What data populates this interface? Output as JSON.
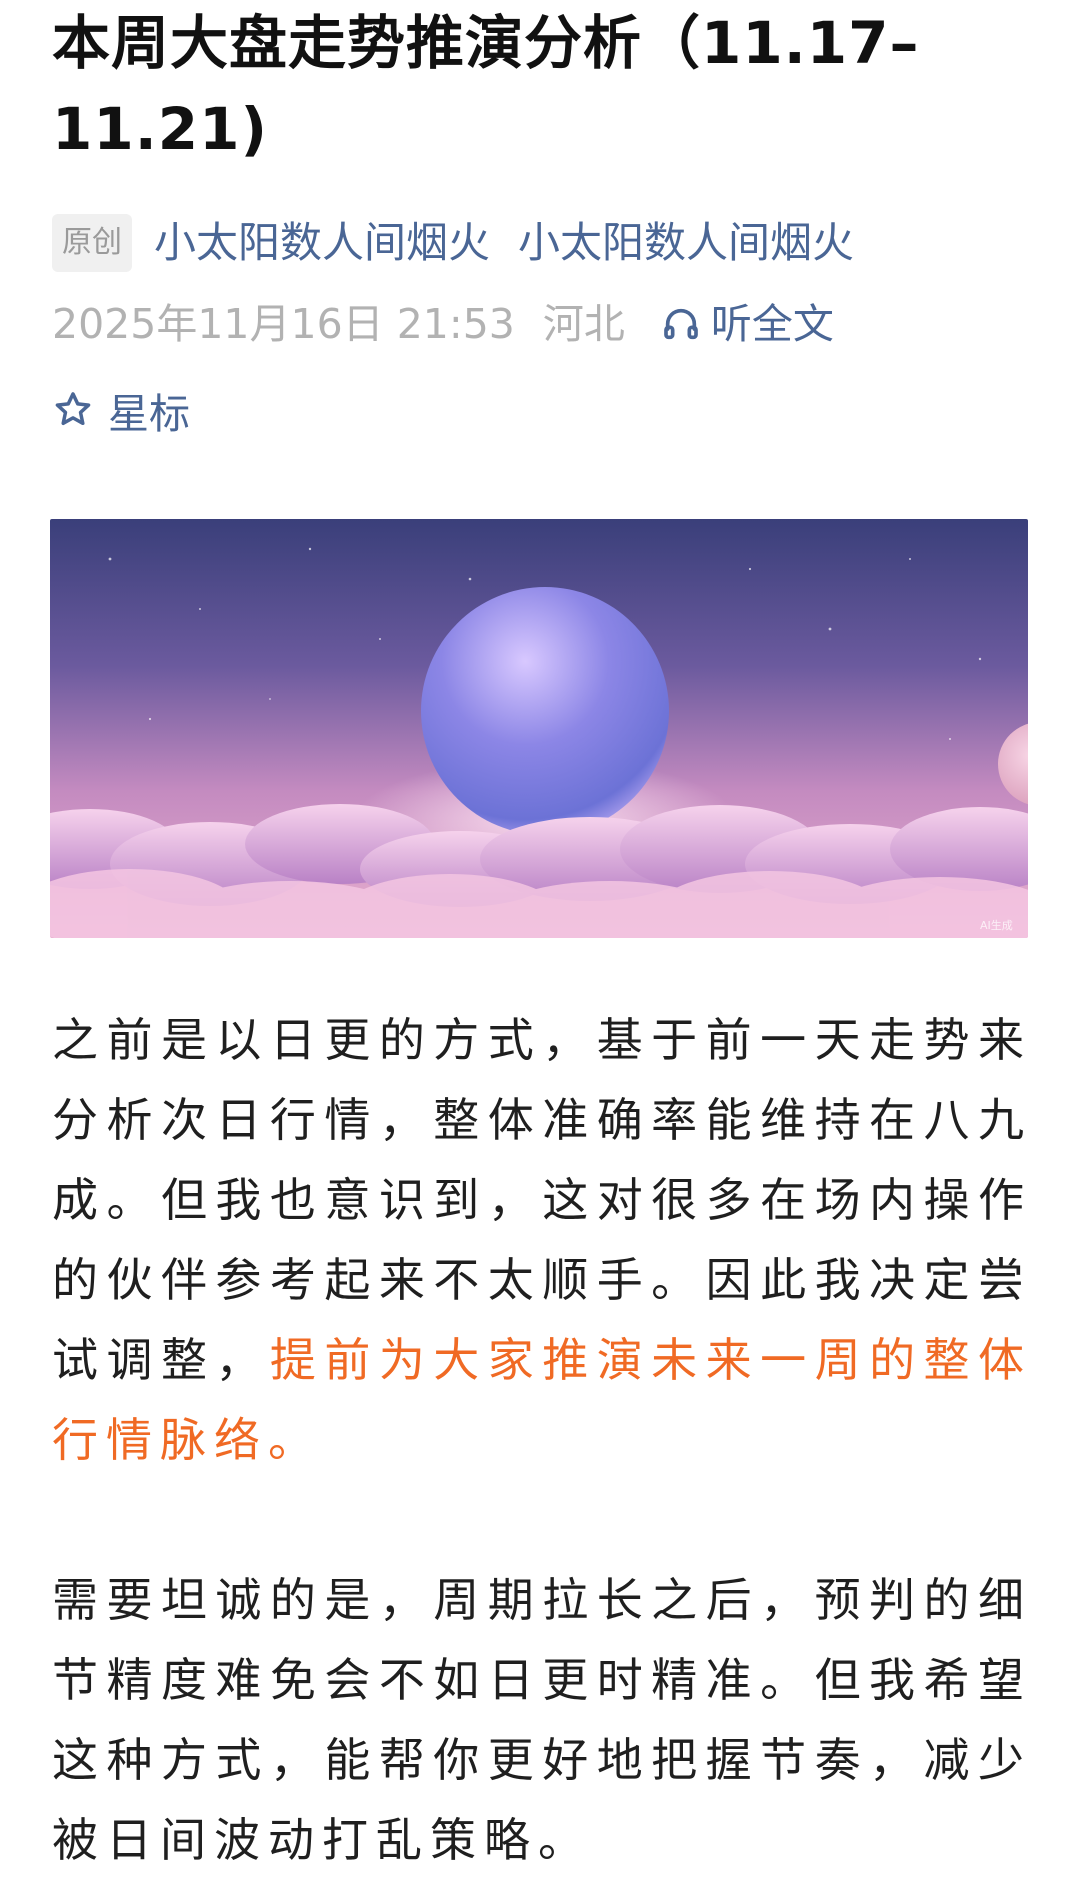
{
  "article": {
    "title": "本周大盘走势推演分析（11.17–11.21)",
    "badge": "原创",
    "author_name": "小太阳数人间烟火",
    "account_name": "小太阳数人间烟火",
    "publish_time": "2025年11月16日 21:53",
    "location": "河北",
    "listen_label": "听全文",
    "star_label": "星标",
    "hero_watermark": "AI生成",
    "paragraphs": [
      {
        "text_before": "之前是以日更的方式，基于前一天走势来分析次日行情，整体准确率能维持在八九成。但我也意识到，这对很多在场内操作的伙伴参考起来不太顺手。因此我决定尝试调整，",
        "highlight": "提前为大家推演未来一周的整体行情脉络。"
      },
      {
        "text": "需要坦诚的是，周期拉长之后，预判的细节精度难免会不如日更时精准。但我希望这种方式，能帮你更好地把握节奏，减少被日间波动打乱策略。"
      }
    ]
  },
  "colors": {
    "link": "#4a6695",
    "meta_grey": "#b2b2b2",
    "highlight": "#f06a24",
    "badge_bg": "#f0f0f0"
  }
}
